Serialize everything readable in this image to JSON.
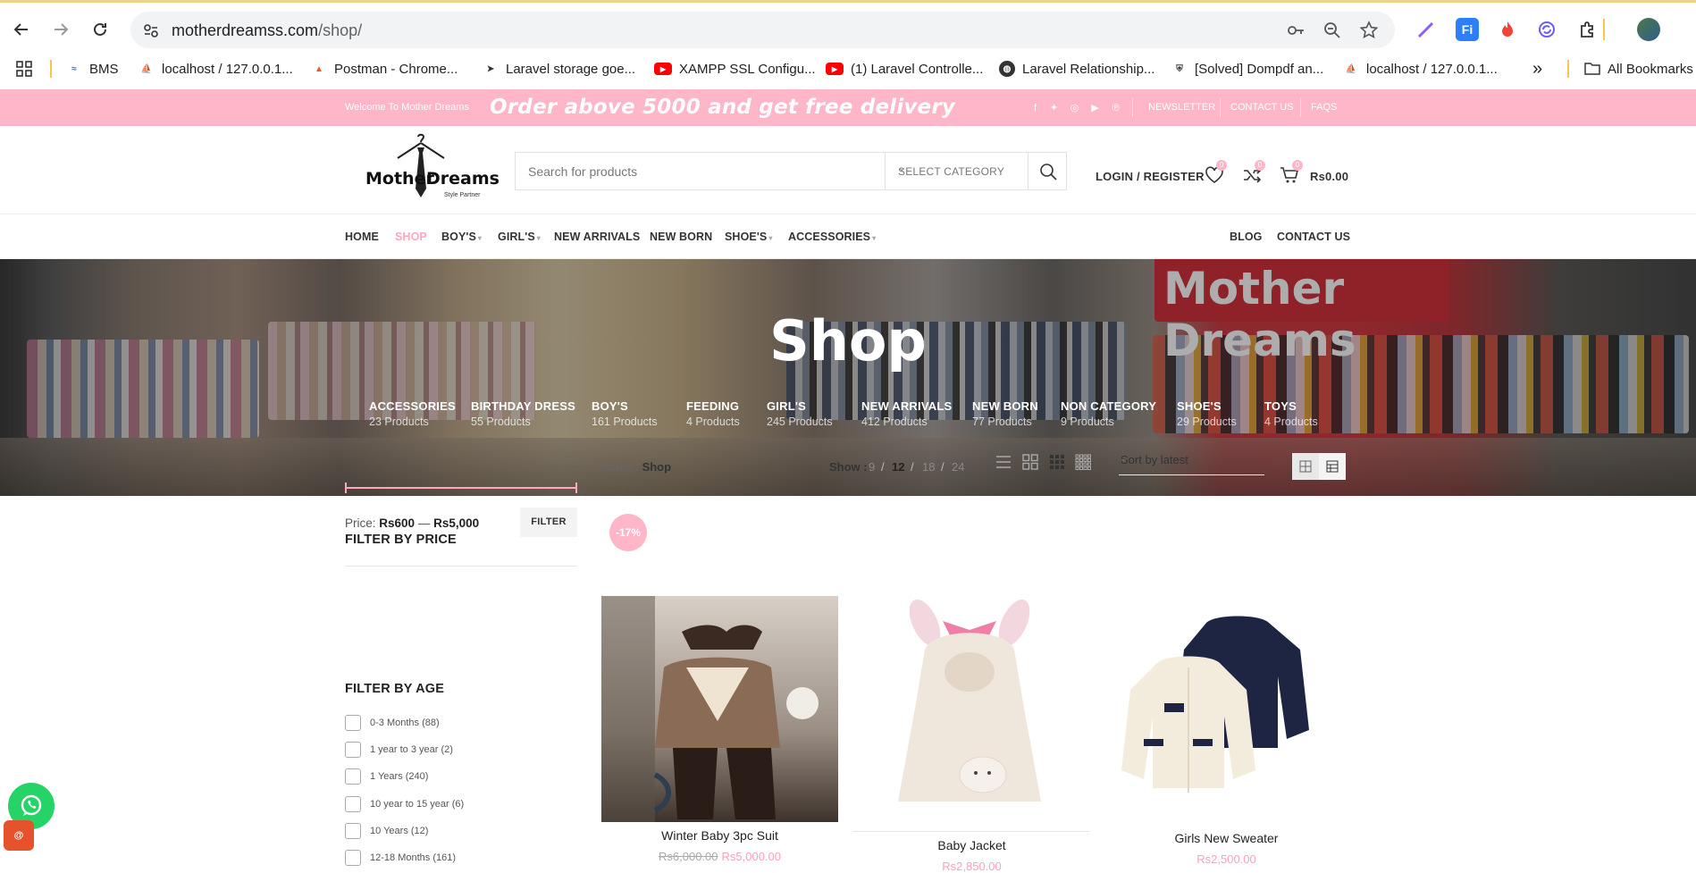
{
  "browser": {
    "url_host": "motherdreamss.com",
    "url_path": "/shop/",
    "bookmarks": [
      {
        "label": "BMS"
      },
      {
        "label": "localhost / 127.0.0.1..."
      },
      {
        "label": "Postman - Chrome..."
      },
      {
        "label": "Laravel storage goe..."
      },
      {
        "label": "XAMPP SSL Configu..."
      },
      {
        "label": "(1) Laravel Controlle..."
      },
      {
        "label": "Laravel Relationship..."
      },
      {
        "label": "[Solved] Dompdf an..."
      },
      {
        "label": "localhost / 127.0.0.1..."
      }
    ],
    "more": "»",
    "all_bookmarks": "All Bookmarks"
  },
  "topbar": {
    "welcome": "Welcome To Mother Dreams",
    "promo": "Order above 5000 and get free delivery",
    "links": [
      "NEWSLETTER",
      "CONTACT US",
      "FAQS"
    ]
  },
  "header": {
    "logo_line1": "Mother",
    "logo_line2": "Dreams",
    "logo_tagline": "Style Partner",
    "search_placeholder": "Search for products",
    "category_label": "SELECT CATEGORY",
    "login": "LOGIN / REGISTER",
    "wishlist_count": "0",
    "compare_count": "0",
    "cart_count": "0",
    "cart_total": "Rs0.00"
  },
  "menu": {
    "items": [
      "HOME",
      "SHOP",
      "BOY'S",
      "GIRL'S",
      "NEW ARRIVALS",
      "NEW BORN",
      "SHOE'S",
      "ACCESSORIES"
    ],
    "right": [
      "BLOG",
      "CONTACT US"
    ]
  },
  "hero": {
    "title": "Shop",
    "sign": "Mother Dreams",
    "categories": [
      {
        "name": "ACCESSORIES",
        "count": "23 Products"
      },
      {
        "name": "BIRTHDAY DRESS",
        "count": "55 Products"
      },
      {
        "name": "BOY'S",
        "count": "161 Products"
      },
      {
        "name": "FEEDING",
        "count": "4 Products"
      },
      {
        "name": "GIRL'S",
        "count": "245 Products"
      },
      {
        "name": "NEW ARRIVALS",
        "count": "412 Products"
      },
      {
        "name": "NEW BORN",
        "count": "77 Products"
      },
      {
        "name": "NON CATEGORY",
        "count": "9 Products"
      },
      {
        "name": "SHOE'S",
        "count": "29 Products"
      },
      {
        "name": "TOYS",
        "count": "4 Products"
      }
    ]
  },
  "sidebar": {
    "price_heading": "FILTER BY PRICE",
    "price_label": "Price:",
    "price_min": "Rs600",
    "price_sep": "—",
    "price_max": "Rs5,000",
    "filter_button": "FILTER",
    "age_heading": "FILTER BY AGE",
    "ages": [
      "0-3 Months (88)",
      "1 year to 3 year (2)",
      "1 Years (240)",
      "10 year to 15 year (6)",
      "10 Years (12)",
      "12-18 Months (161)"
    ]
  },
  "toolbar": {
    "crumb_home": "Home",
    "crumb_sep": "/",
    "crumb_current": "Shop",
    "show_label": "Show :",
    "show_options": [
      "9",
      "12",
      "18",
      "24"
    ],
    "show_selected": "12",
    "sort_label": "Sort by latest"
  },
  "products": [
    {
      "title": "Winter Baby 3pc Suit",
      "old_price": "Rs6,000.00",
      "price": "Rs5,000.00",
      "badge": "-17%"
    },
    {
      "title": "Baby Jacket",
      "old_price": "",
      "price": "Rs2,850.00",
      "badge": ""
    },
    {
      "title": "Girls New Sweater",
      "old_price": "",
      "price": "Rs2,500.00",
      "badge": ""
    }
  ],
  "colors": {
    "accent": "#ffb6c8",
    "price": "#ffa0b6",
    "whatsapp": "#25d366"
  }
}
